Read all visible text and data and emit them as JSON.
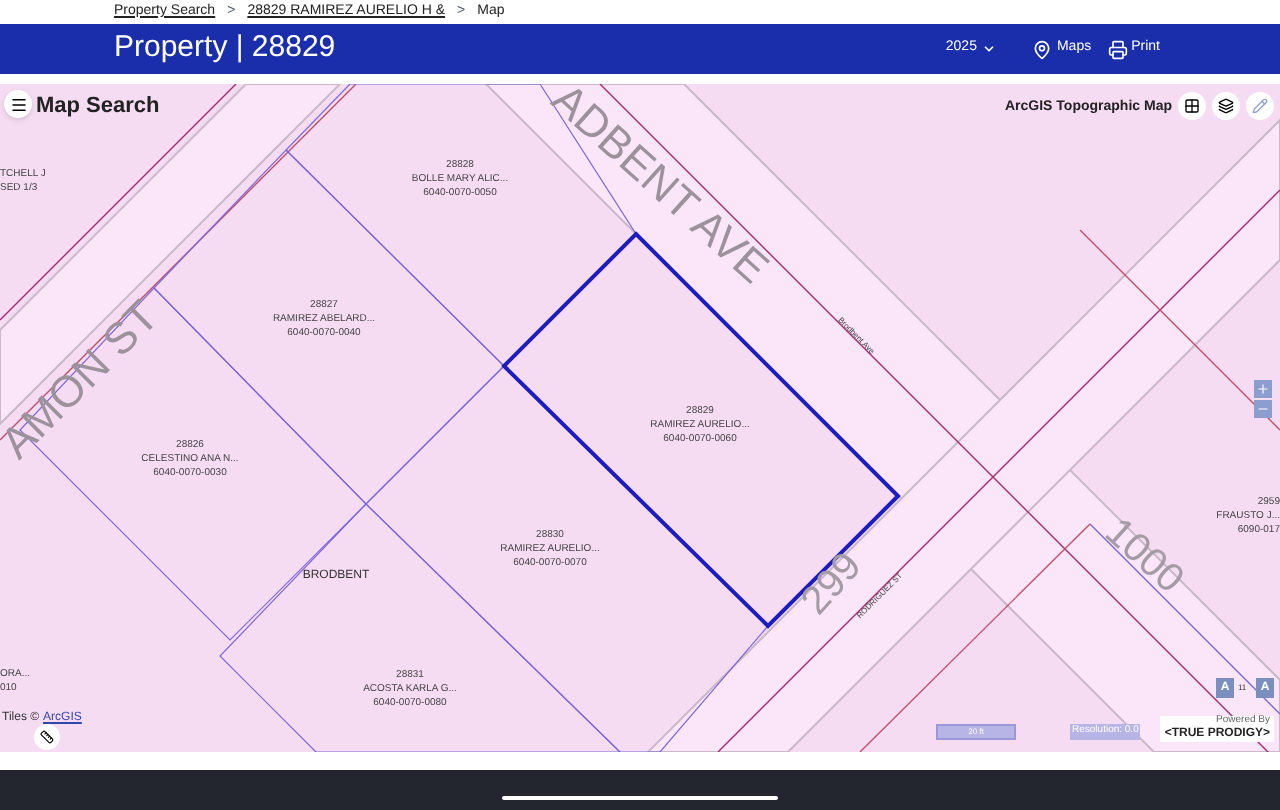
{
  "breadcrumb": [
    {
      "label": "Property Search",
      "kind": "link"
    },
    {
      "label": "28829 RAMIREZ AURELIO H &",
      "kind": "link"
    },
    {
      "label": "Map",
      "kind": "current"
    }
  ],
  "breadcrumb_separator": ">",
  "header": {
    "title": "Property | 28829",
    "year": "2025",
    "actions": [
      {
        "label": "Maps",
        "kind": "maps"
      },
      {
        "label": "Print",
        "kind": "print"
      }
    ]
  },
  "map": {
    "panel_title": "Map Search",
    "basemap_label": "ArcGIS Topographic Map",
    "parcels": [
      {
        "number": "28828",
        "owner": "BOLLE MARY ALIC...",
        "account": "6040-0070-0050",
        "selected": false
      },
      {
        "number": "28827",
        "owner": "RAMIREZ ABELARD...",
        "account": "6040-0070-0040",
        "selected": false
      },
      {
        "number": "28826",
        "owner": "CELESTINO ANA N...",
        "account": "6040-0070-0030",
        "selected": false
      },
      {
        "number": "28829",
        "owner": "RAMIREZ AURELIO...",
        "account": "6040-0070-0060",
        "selected": true
      },
      {
        "number": "28830",
        "owner": "RAMIREZ AURELIO...",
        "account": "6040-0070-0070",
        "selected": false
      },
      {
        "number": "28831",
        "owner": "ACOSTA KARLA G...",
        "account": "6040-0070-0080",
        "selected": false
      }
    ],
    "edge_labels": [
      {
        "lines": [
          "TCHELL J",
          "SED 1/3"
        ]
      },
      {
        "lines": [
          "ORA...",
          "010"
        ]
      },
      {
        "lines": [
          "2959",
          "FRAUSTO J...",
          "6090-017"
        ]
      }
    ],
    "streets": [
      "ADBENT AVE",
      "AMON ST",
      "BRODBENT",
      "Brodbent Ave",
      "RODRIGUEZ ST",
      "1000",
      "299"
    ],
    "attribution": {
      "text": "Tiles ©",
      "link": "ArcGIS"
    },
    "font_buttons": [
      "A",
      "A"
    ],
    "font_size": "11",
    "scale": "20 ft",
    "resolution": "Resolution: 0.0",
    "logo": {
      "caption": "Powered By",
      "name": "<TRUE PRODIGY>"
    }
  }
}
